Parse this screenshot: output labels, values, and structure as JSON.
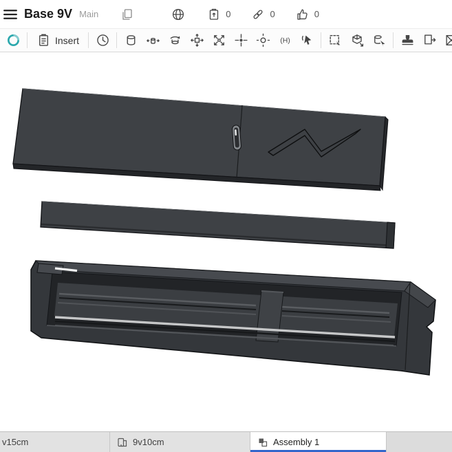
{
  "colors": {
    "part_body": "#3e4145",
    "logo_teal": "#2ba8ad",
    "active_tab_underline": "#3366cc",
    "toolbar_icon": "#474747"
  },
  "header": {
    "title": "Base 9V",
    "workspace": "Main",
    "counts": {
      "copies": "0",
      "links": "0",
      "likes": "0"
    }
  },
  "toolbar": {
    "insert_label": "Insert",
    "groups": [
      [
        "clock"
      ],
      [
        "part",
        "mate",
        "rotate",
        "move",
        "explode",
        "snap",
        "position",
        "named-position",
        "select"
      ],
      [
        "box-select",
        "insert-part",
        "query"
      ],
      [
        "stamp",
        "configure",
        "appearance"
      ]
    ]
  },
  "viewport": {
    "parts": [
      "lid",
      "spacer-plate",
      "battery-tray"
    ]
  },
  "tabs": {
    "items": [
      {
        "label": "v15cm",
        "active": false
      },
      {
        "label": "9v10cm",
        "active": false
      },
      {
        "label": "Assembly 1",
        "active": true
      }
    ]
  }
}
